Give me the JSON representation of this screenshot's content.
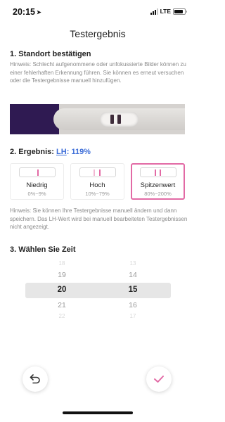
{
  "status_bar": {
    "time": "20:15",
    "location_icon": "location-arrow-icon",
    "network": "LTE",
    "signal_bars": "3 of 4",
    "battery_level": 0.85
  },
  "header": {
    "title": "Testergebnis"
  },
  "section1": {
    "title": "1. Standort bestätigen",
    "hint": "Hinweis: Schlecht aufgenommene oder unfokussierte Bilder können zu einer fehlerhaften Erkennung führen. Sie können es erneut versuchen oder die Testergebnisse manuell hinzufügen."
  },
  "section2": {
    "title_prefix": "2. Ergebnis: ",
    "lh_link": "LH",
    "separator": ": ",
    "percent": "119%",
    "options": [
      {
        "name": "Niedrig",
        "range": "0%~9%",
        "selected": false
      },
      {
        "name": "Hoch",
        "range": "10%~79%",
        "selected": false
      },
      {
        "name": "Spitzenwert",
        "range": "80%~200%",
        "selected": true
      }
    ],
    "hint": "Hinweis: Sie können Ihre Testergebnisse manuell ändern und dann speichern. Das LH-Wert wird bei manuell bearbeiteten Testergebnissen nicht angezeigt."
  },
  "section3": {
    "title": "3. Wählen Sie Zeit",
    "hours": [
      "18",
      "19",
      "20",
      "21",
      "22"
    ],
    "minutes": [
      "13",
      "14",
      "15",
      "16",
      "17"
    ],
    "selected_hour": "20",
    "selected_minute": "15"
  },
  "actions": {
    "undo_icon": "undo-arrow-icon",
    "confirm_icon": "checkmark-icon",
    "accent_color": "#e26aa5",
    "link_color": "#3f6fd8"
  }
}
